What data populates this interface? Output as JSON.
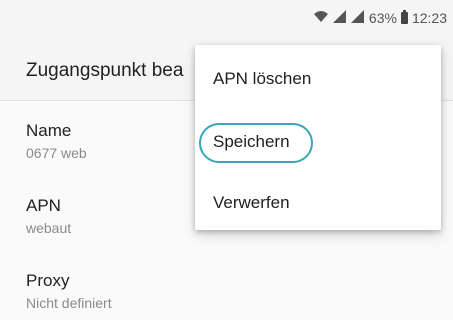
{
  "statusbar": {
    "wifi_icon": "wifi-icon",
    "signal_icon": "signal-icon",
    "battery_percent": "63%",
    "time": "12:23"
  },
  "appbar": {
    "title": "Zugangspunkt bea"
  },
  "prefs": [
    {
      "title": "Name",
      "summary": "0677 web"
    },
    {
      "title": "APN",
      "summary": "webaut"
    },
    {
      "title": "Proxy",
      "summary": "Nicht definiert"
    }
  ],
  "menu": {
    "items": [
      {
        "label": "APN löschen"
      },
      {
        "label": "Speichern"
      },
      {
        "label": "Verwerfen"
      }
    ]
  },
  "colors": {
    "highlight_ring": "#3aa6b9"
  }
}
